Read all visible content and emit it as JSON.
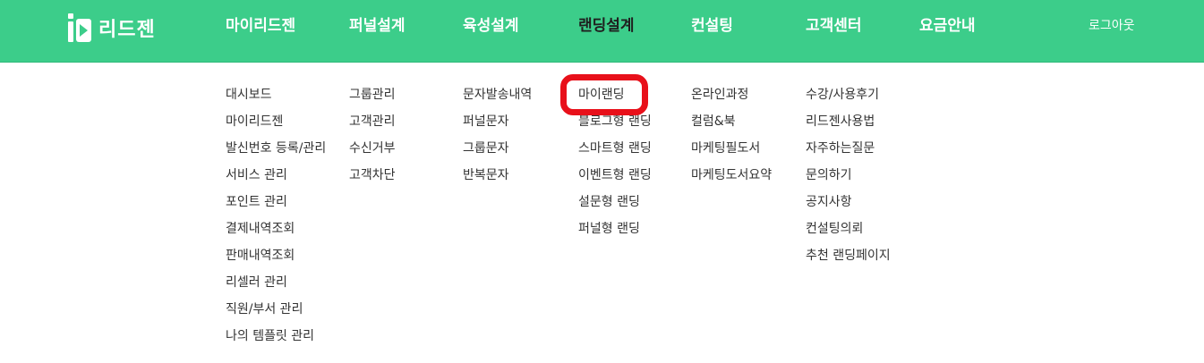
{
  "brand": {
    "name": "리드젠",
    "color": "#3ccd8a"
  },
  "nav": {
    "items": [
      {
        "label": "마이리드젠",
        "active": false
      },
      {
        "label": "퍼널설계",
        "active": false
      },
      {
        "label": "육성설계",
        "active": false
      },
      {
        "label": "랜딩설계",
        "active": true
      },
      {
        "label": "컨설팅",
        "active": false
      },
      {
        "label": "고객센터",
        "active": false
      },
      {
        "label": "요금안내",
        "active": false
      }
    ],
    "logout": "로그아웃"
  },
  "submenu": {
    "col0": [
      "대시보드",
      "마이리드젠",
      "발신번호 등록/관리",
      "서비스 관리",
      "포인트 관리",
      "결제내역조회",
      "판매내역조회",
      "리셀러 관리",
      "직원/부서 관리",
      "나의 템플릿 관리"
    ],
    "col1": [
      "그룹관리",
      "고객관리",
      "수신거부",
      "고객차단"
    ],
    "col2": [
      "문자발송내역",
      "퍼널문자",
      "그룹문자",
      "반복문자"
    ],
    "col3": [
      "마이랜딩",
      "블로그형 랜딩",
      "스마트형 랜딩",
      "이벤트형 랜딩",
      "설문형 랜딩",
      "퍼널형 랜딩"
    ],
    "col4": [
      "온라인과정",
      "컬럼&북",
      "마케팅필도서",
      "마케팅도서요약"
    ],
    "col5": [
      "수강/사용후기",
      "리드젠사용법",
      "자주하는질문",
      "문의하기",
      "공지사항",
      "컨설팅의뢰",
      "추천 랜딩페이지"
    ]
  },
  "annotation": {
    "highlight_color": "#e8101a"
  }
}
